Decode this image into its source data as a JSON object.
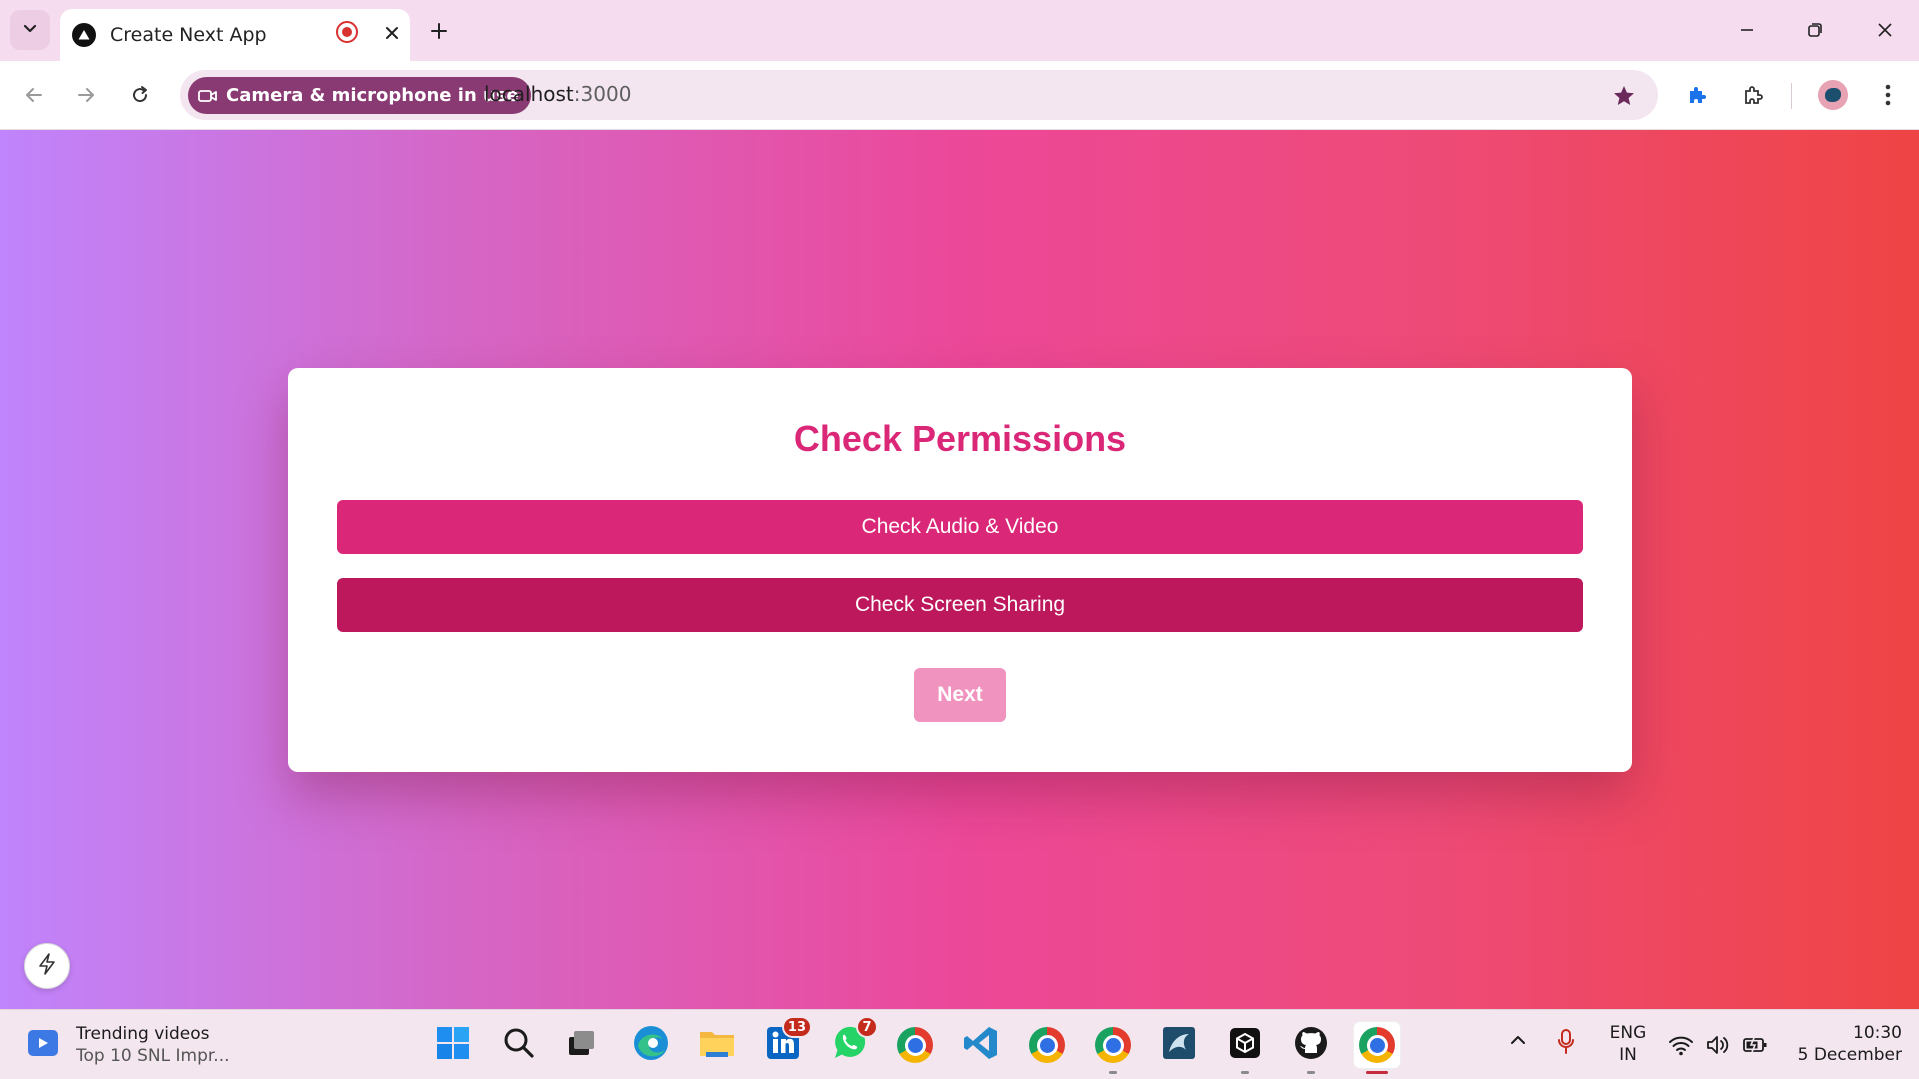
{
  "browser": {
    "tab_title": "Create Next App",
    "permission_chip": "Camera & microphone in use",
    "url_host": "localhost",
    "url_port": ":3000"
  },
  "page": {
    "title": "Check Permissions",
    "buttons": {
      "audio_video": "Check Audio & Video",
      "screen_sharing": "Check Screen Sharing",
      "next": "Next"
    },
    "colors": {
      "title": "#db2777",
      "audio_video_button": "#db2777",
      "screen_sharing_button": "#be185d",
      "next_button_disabled": "#f093bf"
    }
  },
  "taskbar": {
    "widget_title": "Trending videos",
    "widget_subtitle": "Top 10 SNL Impr...",
    "linkedin_badge": "13",
    "whatsapp_badge": "7",
    "language_top": "ENG",
    "language_bottom": "IN",
    "time": "10:30",
    "date": "5 December"
  }
}
